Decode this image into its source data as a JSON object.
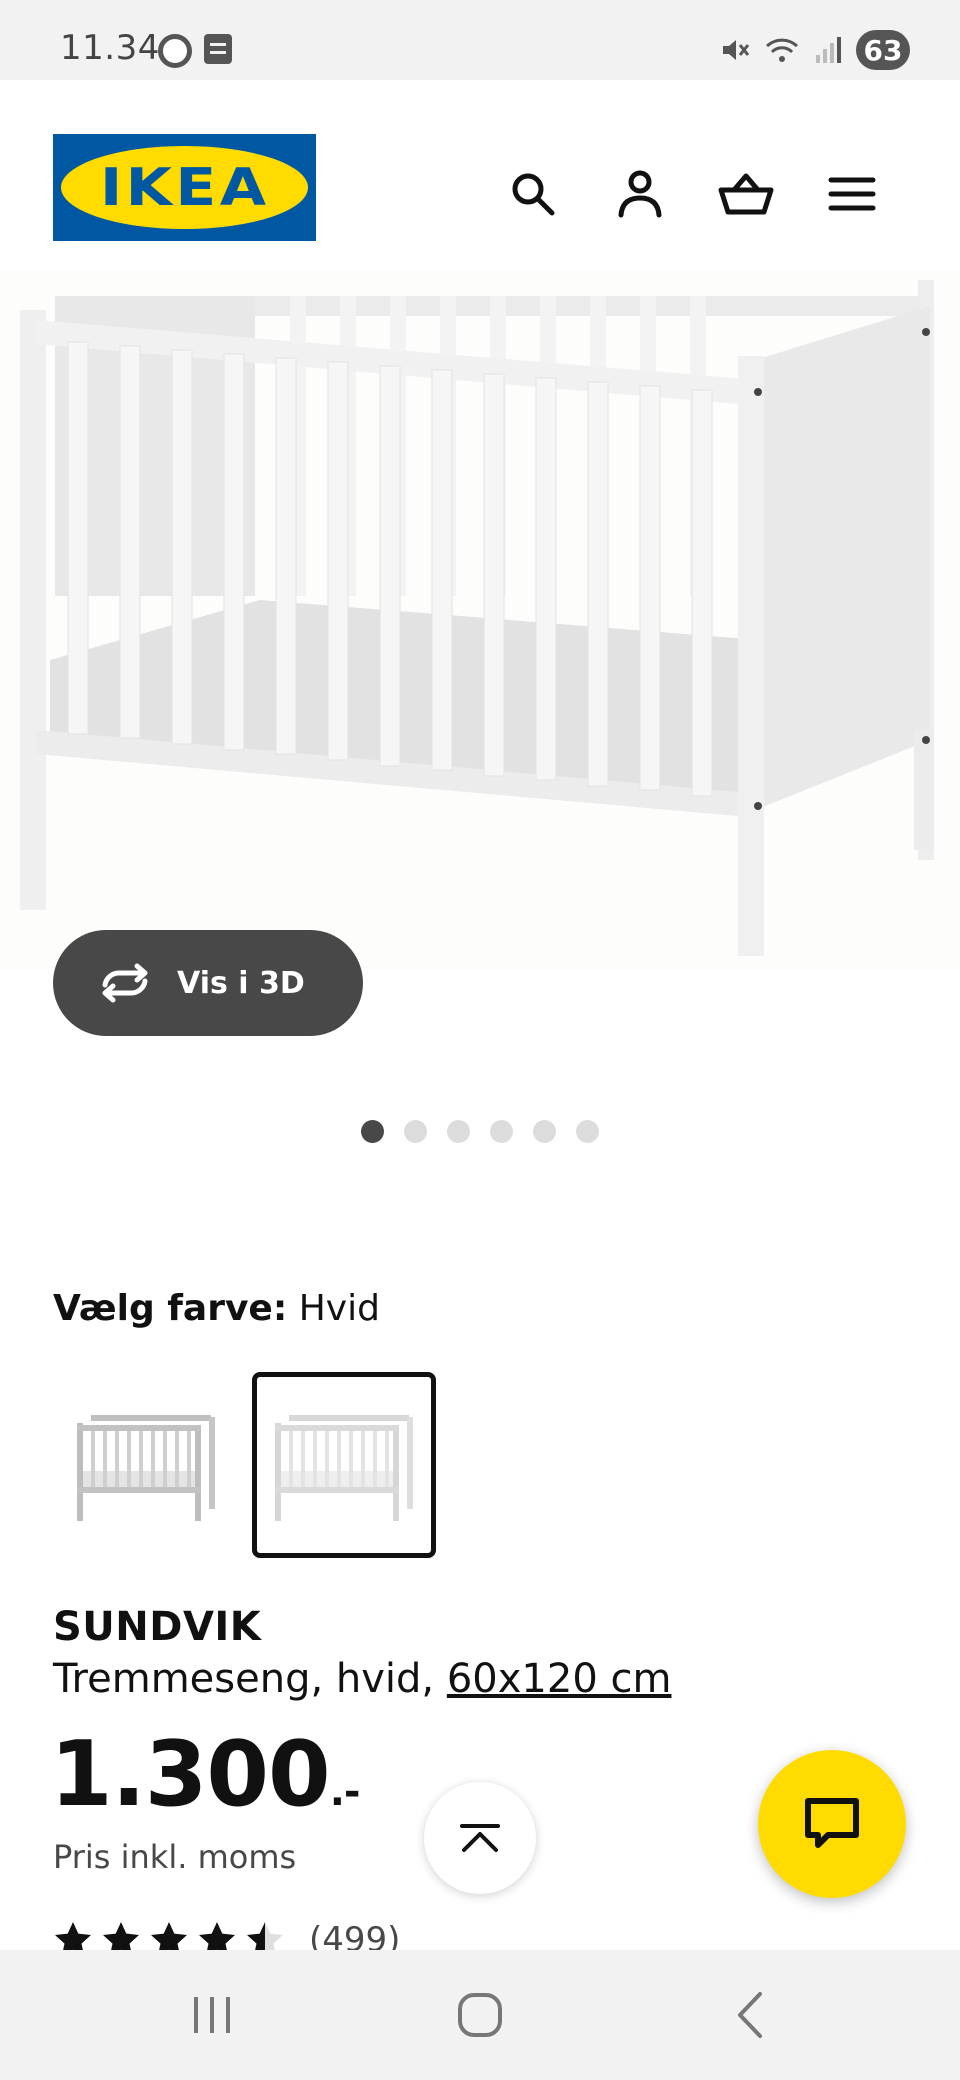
{
  "status_bar": {
    "time": "11.34",
    "battery": "63"
  },
  "header": {
    "logo_text": "IKEA",
    "brand_colors": {
      "blue": "#0058a3",
      "yellow": "#ffdb00"
    },
    "icons": [
      "search-icon",
      "account-icon",
      "basket-icon",
      "menu-icon"
    ]
  },
  "gallery": {
    "view_3d_label": "Vis i 3D",
    "image_count": 6,
    "active_index": 0
  },
  "color_picker": {
    "label": "Vælg farve:",
    "value": "Hvid",
    "selected_index": 1
  },
  "product": {
    "name": "SUNDVIK",
    "description_prefix": "Tremmeseng, hvid,",
    "size_link": "60x120 cm",
    "price": "1.300",
    "price_suffix": ".-",
    "price_note": "Pris inkl. moms",
    "rating_value": 4.5,
    "rating_count": "(499)"
  }
}
